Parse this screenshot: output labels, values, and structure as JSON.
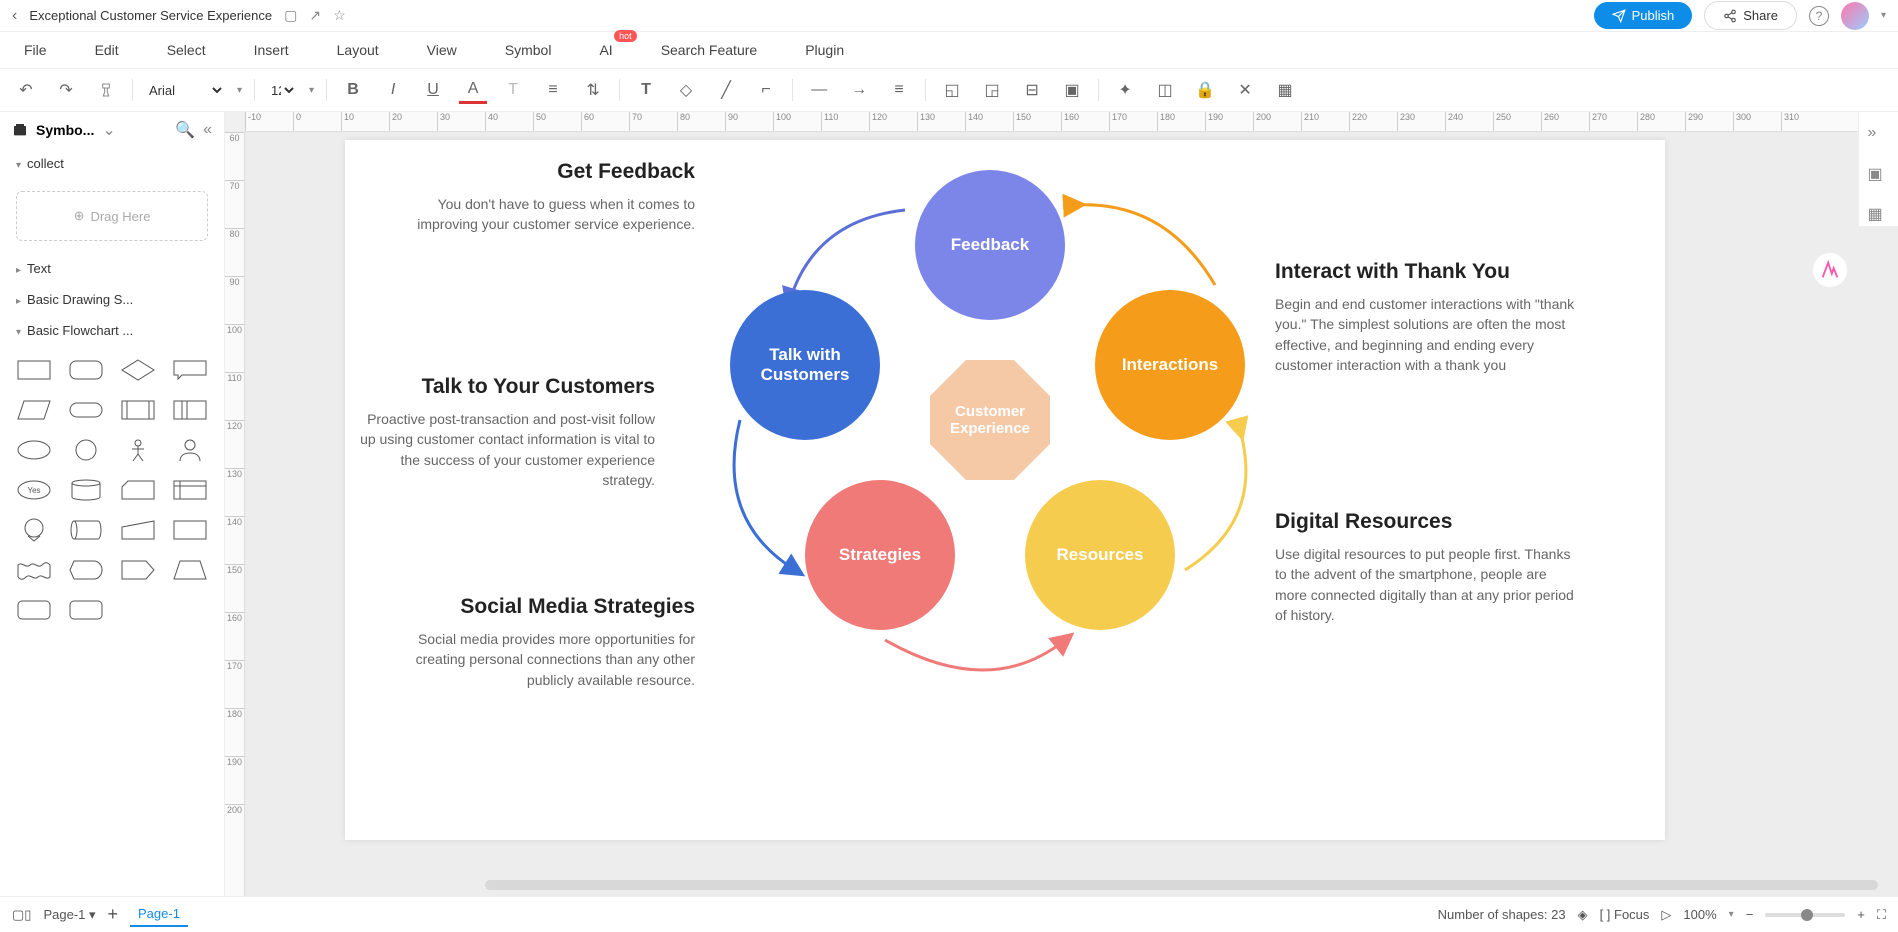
{
  "titlebar": {
    "title": "Exceptional Customer Service Experience",
    "publish": "Publish",
    "share": "Share"
  },
  "menubar": {
    "items": [
      "File",
      "Edit",
      "Select",
      "Insert",
      "Layout",
      "View",
      "Symbol",
      "AI",
      "Search Feature",
      "Plugin"
    ],
    "hot_tag": "hot",
    "hot_index": 7
  },
  "toolbar": {
    "font": "Arial",
    "font_size": "12"
  },
  "sidebar": {
    "title": "Symbo...",
    "sections": {
      "collect": "collect",
      "drag": "Drag Here",
      "text": "Text",
      "basic_drawing": "Basic Drawing S...",
      "basic_flowchart": "Basic Flowchart ..."
    }
  },
  "ruler_h": [
    "-10",
    "0",
    "10",
    "20",
    "30",
    "40",
    "50",
    "60",
    "70",
    "80",
    "90",
    "100",
    "110",
    "120",
    "130",
    "140",
    "150",
    "160",
    "170",
    "180",
    "190",
    "200",
    "210",
    "220",
    "230",
    "240",
    "250",
    "260",
    "270",
    "280",
    "290",
    "300",
    "310"
  ],
  "ruler_v": [
    "60",
    "70",
    "80",
    "90",
    "100",
    "110",
    "120",
    "130",
    "140",
    "150",
    "160",
    "170",
    "180",
    "190",
    "200"
  ],
  "diagram": {
    "center": "Customer Experience",
    "nodes": {
      "feedback": "Feedback",
      "talk": "Talk with Customers",
      "interactions": "Interactions",
      "strategies": "Strategies",
      "resources": "Resources"
    },
    "labels": {
      "feedback": {
        "title": "Get Feedback",
        "body": "You don't have to guess when it comes to improving your customer service experience."
      },
      "talk": {
        "title": "Talk to Your Customers",
        "body": "Proactive post-transaction and post-visit follow up using customer contact information is vital to the success of your customer experience strategy."
      },
      "social": {
        "title": "Social Media Strategies",
        "body": "Social media provides more opportunities for creating personal connections than any other publicly available resource."
      },
      "interact": {
        "title": "Interact with Thank You",
        "body": "Begin and end customer interactions with \"thank you.\" The simplest solutions are often the most effective, and beginning and ending every customer interaction with a thank you"
      },
      "digital": {
        "title": "Digital Resources",
        "body": "Use digital resources to put people first. Thanks to the advent of the smartphone, people are more connected digitally than at any prior period of history."
      }
    }
  },
  "bottombar": {
    "page_select": "Page-1",
    "page_tab": "Page-1",
    "shape_count": "Number of shapes: 23",
    "focus": "Focus",
    "zoom": "100%"
  },
  "shape_label_yes": "Yes"
}
